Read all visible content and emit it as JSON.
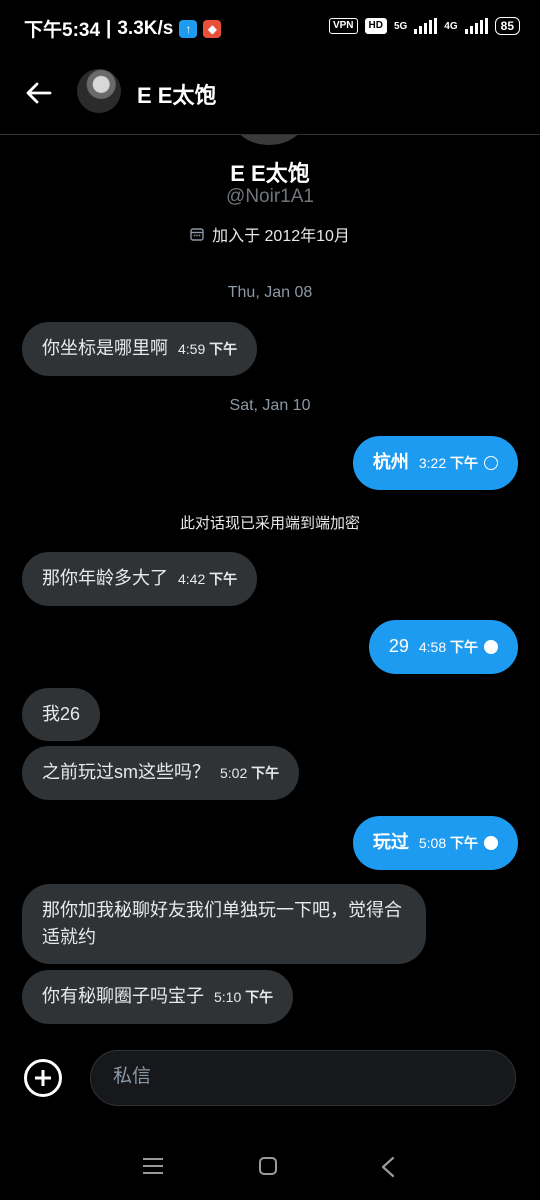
{
  "status": {
    "time": "下午5:34",
    "speed": "3.3K/s",
    "vpn": "VPN",
    "hd": "HD",
    "net1": "5G",
    "net2": "4G",
    "battery": "85"
  },
  "header": {
    "name": "E E太饱"
  },
  "profile": {
    "name": "E E太饱",
    "handle": "@Noir1A1",
    "joined": "加入于 2012年10月"
  },
  "dates": [
    "Thu, Jan 08",
    "Sat, Jan 10"
  ],
  "notice": "此对话现已采用端到端加密",
  "messages": [
    {
      "dir": "in",
      "text": "你坐标是哪里啊",
      "time": "4:59",
      "ampm": "下午"
    },
    {
      "dir": "out",
      "text": "杭州",
      "time": "3:22",
      "ampm": "下午",
      "status": "sent"
    },
    {
      "dir": "in",
      "text": "那你年龄多大了",
      "time": "4:42",
      "ampm": "下午"
    },
    {
      "dir": "out",
      "text": "29",
      "time": "4:58",
      "ampm": "下午",
      "status": "read"
    },
    {
      "dir": "in",
      "text": "我26"
    },
    {
      "dir": "in",
      "text": "之前玩过sm这些吗？",
      "time": "5:02",
      "ampm": "下午"
    },
    {
      "dir": "out",
      "text": "玩过",
      "time": "5:08",
      "ampm": "下午",
      "status": "read"
    },
    {
      "dir": "in",
      "text": "那你加我秘聊好友我们单独玩一下吧，觉得合适就约"
    },
    {
      "dir": "in",
      "text": "你有秘聊圈子吗宝子",
      "time": "5:10",
      "ampm": "下午"
    }
  ],
  "composer": {
    "placeholder": "私信"
  },
  "colors": {
    "accent": "#1d9bf0",
    "incoming": "#2f3336",
    "background": "#000000"
  }
}
